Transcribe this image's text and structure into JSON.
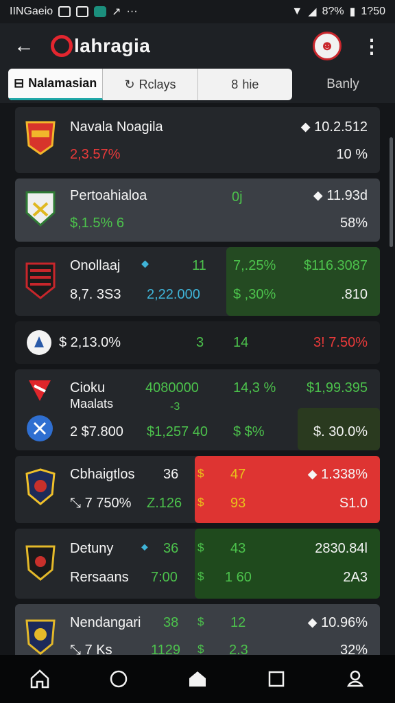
{
  "status": {
    "left_text": "IINGaeio",
    "battery_text": "8?%",
    "time": "1?50"
  },
  "app": {
    "back_icon": "back-arrow-icon",
    "title": "lahragia",
    "title_prefix": "O",
    "mascot_icon": "mascot-icon",
    "menu_icon": "more-vertical-icon"
  },
  "tabs": [
    {
      "label": "Nalamasian",
      "icon": "list-icon",
      "active": true
    },
    {
      "label": "Rclays",
      "icon": "refresh-icon"
    },
    {
      "label": "hie",
      "icon": "eight-icon"
    }
  ],
  "tab_extra": "Banly",
  "rows": [
    {
      "name": "Navala Noagila",
      "sub": "2,3.57%",
      "c1": "",
      "c2": "",
      "price": "10.2.512",
      "pct": "10 %"
    },
    {
      "name": "Pertoahialoa",
      "sub": "$,1.5% 6",
      "c1": "0j",
      "c2": "",
      "price": "11.93d",
      "pct": "58%"
    },
    {
      "name": "Onollaaj",
      "sub": "8,7. 3S3",
      "c1": "11",
      "c1b": "2,22.000",
      "c2": "7,.25%",
      "c2b": "$ ,30%",
      "price": "$116.3087",
      "pct": ".810"
    },
    {
      "name": "$ 2,13.0%",
      "c1": "3",
      "c2": "14",
      "price": "3! 7.50%"
    },
    {
      "name": "Cioku",
      "name2": "Maalats",
      "sub": "2 $7.800",
      "c1": "4080000",
      "c1m": "-3",
      "c1b": "$1,257 40",
      "c2": "14,3 %",
      "c2b": "$ $%",
      "price": "$1,99.395",
      "pct": "$. 30.0%"
    },
    {
      "name": "Cbhaigtlos",
      "c0": "36",
      "sub": "7 750%",
      "c0b": "Z.126",
      "c1": "47",
      "c1b": "93",
      "price": "1.338%",
      "pct": "S1.0"
    },
    {
      "name": "Detuny",
      "sub": "Rersaans",
      "c0": "36",
      "c0b": "7:00",
      "c1": "43",
      "c1b": "1 60",
      "price": "2830.84l",
      "pct": "2A3"
    },
    {
      "name": "Nendangari",
      "sub": "7 Ks",
      "c0": "38",
      "c0b": "1129",
      "c1": "12",
      "c1b": "2.3",
      "price": "10.96%",
      "pct": "32%"
    }
  ],
  "nav": [
    "home-icon",
    "circle-icon",
    "house-filled-icon",
    "square-icon",
    "location-icon"
  ]
}
